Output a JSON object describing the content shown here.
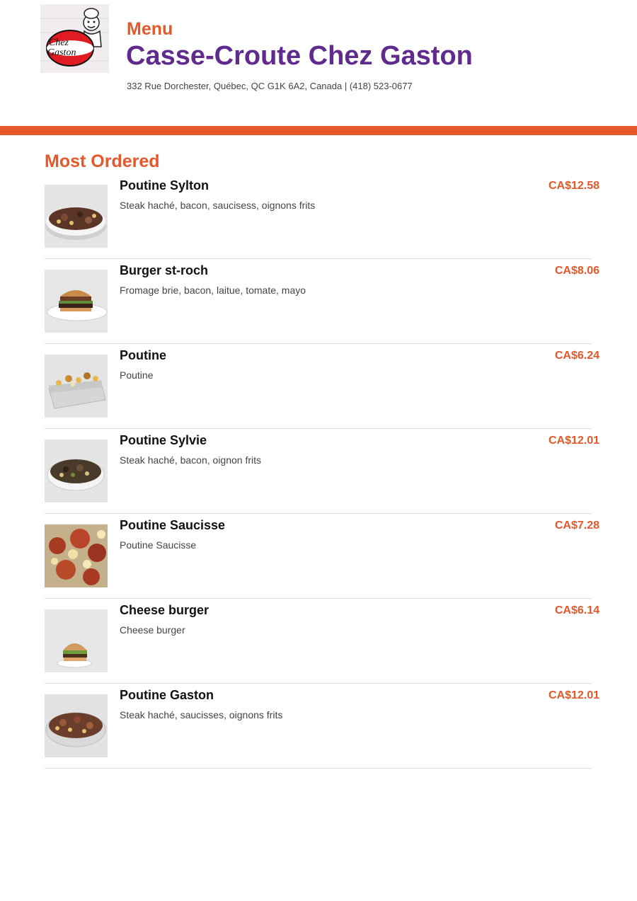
{
  "header": {
    "logo_text": "Chez Gaston",
    "menu_label": "Menu",
    "restaurant_name": "Casse-Croute Chez Gaston",
    "address": "332 Rue Dorchester, Québec, QC G1K 6A2, Canada | (418) 523-0677"
  },
  "colors": {
    "accent": "#e4582a",
    "brand": "#5f2b8f",
    "divider": "#dcdcdc"
  },
  "section": {
    "title": "Most Ordered"
  },
  "items": [
    {
      "name": "Poutine Sylton",
      "description": "Steak haché, bacon, saucisess, oignons frits",
      "price": "CA$12.58"
    },
    {
      "name": "Burger st-roch",
      "description": "Fromage brie, bacon, laitue, tomate, mayo",
      "price": "CA$8.06"
    },
    {
      "name": "Poutine",
      "description": "Poutine",
      "price": "CA$6.24"
    },
    {
      "name": "Poutine Sylvie",
      "description": "Steak haché, bacon, oignon frits",
      "price": "CA$12.01"
    },
    {
      "name": "Poutine Saucisse",
      "description": "Poutine Saucisse",
      "price": "CA$7.28"
    },
    {
      "name": "Cheese burger",
      "description": "Cheese burger",
      "price": "CA$6.14"
    },
    {
      "name": "Poutine Gaston",
      "description": "Steak haché, saucisses, oignons frits",
      "price": "CA$12.01"
    }
  ]
}
